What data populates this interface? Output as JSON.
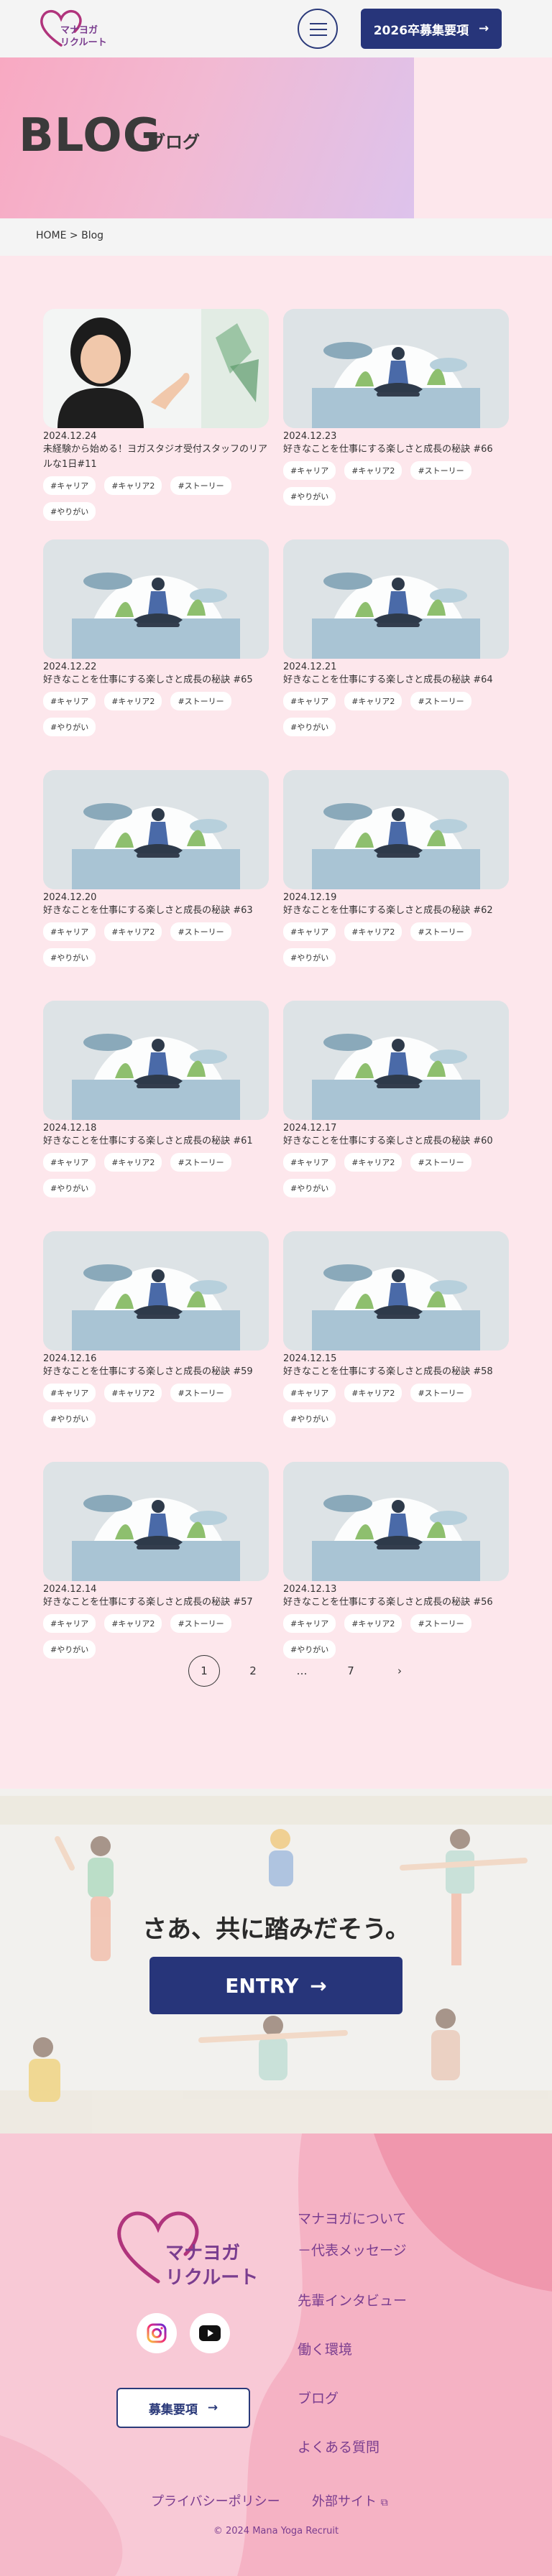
{
  "header": {
    "logo_text_1": "マナヨガ",
    "logo_text_2": "リクルート",
    "menu_label": "menu",
    "recruit_label": "2026卒募集要項",
    "recruit_arrow": "→"
  },
  "hero": {
    "title": "BLOG",
    "subtitle": "ブログ"
  },
  "breadcrumb": "HOME > Blog",
  "posts": [
    {
      "date": "2024.12.24",
      "title": "未経験から始める！ヨガスタジオ受付スタッフのリアルな1日#11",
      "tags": [
        "#キャリア",
        "#キャリア2",
        "#ストーリー",
        "#やりがい"
      ],
      "image": "person-photo"
    },
    {
      "date": "2024.12.23",
      "title": "好きなことを仕事にする楽しさと成長の秘訣 #66",
      "tags": [
        "#キャリア",
        "#キャリア2",
        "#ストーリー",
        "#やりがい"
      ],
      "image": "yoga-illustration"
    },
    {
      "date": "2024.12.22",
      "title": "好きなことを仕事にする楽しさと成長の秘訣 #65",
      "tags": [
        "#キャリア",
        "#キャリア2",
        "#ストーリー",
        "#やりがい"
      ],
      "image": "yoga-illustration"
    },
    {
      "date": "2024.12.21",
      "title": "好きなことを仕事にする楽しさと成長の秘訣 #64",
      "tags": [
        "#キャリア",
        "#キャリア2",
        "#ストーリー",
        "#やりがい"
      ],
      "image": "yoga-illustration"
    },
    {
      "date": "2024.12.20",
      "title": "好きなことを仕事にする楽しさと成長の秘訣 #63",
      "tags": [
        "#キャリア",
        "#キャリア2",
        "#ストーリー",
        "#やりがい"
      ],
      "image": "yoga-illustration"
    },
    {
      "date": "2024.12.19",
      "title": "好きなことを仕事にする楽しさと成長の秘訣 #62",
      "tags": [
        "#キャリア",
        "#キャリア2",
        "#ストーリー",
        "#やりがい"
      ],
      "image": "yoga-illustration"
    },
    {
      "date": "2024.12.18",
      "title": "好きなことを仕事にする楽しさと成長の秘訣 #61",
      "tags": [
        "#キャリア",
        "#キャリア2",
        "#ストーリー",
        "#やりがい"
      ],
      "image": "yoga-illustration"
    },
    {
      "date": "2024.12.17",
      "title": "好きなことを仕事にする楽しさと成長の秘訣 #60",
      "tags": [
        "#キャリア",
        "#キャリア2",
        "#ストーリー",
        "#やりがい"
      ],
      "image": "yoga-illustration"
    },
    {
      "date": "2024.12.16",
      "title": "好きなことを仕事にする楽しさと成長の秘訣 #59",
      "tags": [
        "#キャリア",
        "#キャリア2",
        "#ストーリー",
        "#やりがい"
      ],
      "image": "yoga-illustration"
    },
    {
      "date": "2024.12.15",
      "title": "好きなことを仕事にする楽しさと成長の秘訣 #58",
      "tags": [
        "#キャリア",
        "#キャリア2",
        "#ストーリー",
        "#やりがい"
      ],
      "image": "yoga-illustration"
    },
    {
      "date": "2024.12.14",
      "title": "好きなことを仕事にする楽しさと成長の秘訣 #57",
      "tags": [
        "#キャリア",
        "#キャリア2",
        "#ストーリー",
        "#やりがい"
      ],
      "image": "yoga-illustration"
    },
    {
      "date": "2024.12.13",
      "title": "好きなことを仕事にする楽しさと成長の秘訣 #56",
      "tags": [
        "#キャリア",
        "#キャリア2",
        "#ストーリー",
        "#やりがい"
      ],
      "image": "yoga-illustration"
    }
  ],
  "pagination": {
    "pages": [
      "1",
      "2",
      "…",
      "7"
    ],
    "current": "1",
    "next": "›"
  },
  "cta": {
    "text": "さあ、共に踏みだそう。",
    "button_label": "ENTRY",
    "button_arrow": "→"
  },
  "footer": {
    "logo_text_1": "マナヨガ",
    "logo_text_2": "リクルート",
    "recruit_label": "募集要項",
    "recruit_arrow": "→",
    "nav": [
      "マナヨガについて",
      "－代表メッセージ",
      "先輩インタビュー",
      "働く環境",
      "ブログ",
      "よくある質問"
    ],
    "privacy": "プライバシーポリシー",
    "external": "外部サイト",
    "copyright": "© 2024 Mana Yoga Recruit"
  },
  "colors": {
    "navy": "#27357a",
    "purple": "#7a3d8f",
    "pink_bg": "#fde7ec"
  }
}
